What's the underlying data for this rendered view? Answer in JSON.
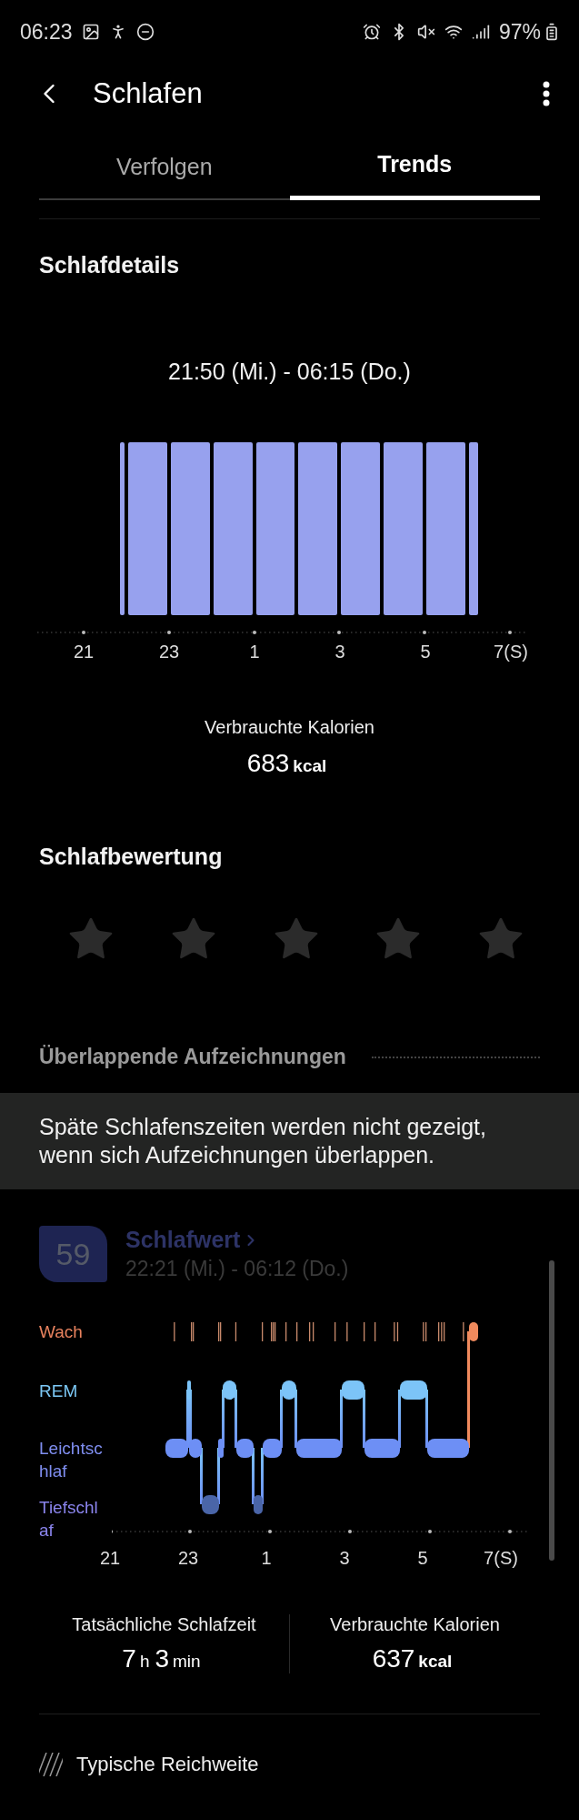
{
  "status_bar": {
    "time": "06:23",
    "battery": "97%"
  },
  "header": {
    "title": "Schlafen"
  },
  "tabs": [
    {
      "label": "Verfolgen",
      "selected": false
    },
    {
      "label": "Trends",
      "selected": true
    }
  ],
  "sleep_details": {
    "title": "Schlafdetails",
    "range": "21:50 (Mi.) - 06:15 (Do.)",
    "x_axis_labels": [
      "21",
      "23",
      "1",
      "3",
      "5",
      "7(S)"
    ],
    "calories_label": "Verbrauchte Kalorien",
    "calories_value": "683",
    "calories_unit": "kcal"
  },
  "rating": {
    "title": "Schlafbewertung",
    "stars": 0
  },
  "overlap": {
    "title": "Überlappende Aufzeichnungen",
    "notice": "Späte Schlafenszeiten werden nicht gezeigt, wenn sich Aufzeichnungen überlappen."
  },
  "record": {
    "score": "59",
    "title": "Schlafwert",
    "range": "22:21 (Mi.) - 06:12 (Do.)",
    "stages": [
      {
        "label": "Wach",
        "color": "#e8825e"
      },
      {
        "label": "REM",
        "color": "#7cc8f5"
      },
      {
        "label": "Leichtschlaf",
        "color": "#7f8ef0"
      },
      {
        "label": "Tiefschlaf",
        "color": "#8a84ec"
      }
    ],
    "x_axis_labels": [
      "21",
      "23",
      "1",
      "3",
      "5",
      "7(S)"
    ],
    "stats": [
      {
        "label": "Tatsächliche Schlafzeit",
        "kind": "duration",
        "parts": [
          {
            "number": "7",
            "unit": "h"
          },
          {
            "number": "3",
            "unit": "min"
          }
        ]
      },
      {
        "label": "Verbrauchte Kalorien",
        "kind": "calories",
        "parts": [
          {
            "number": "637",
            "unit": "kcal"
          }
        ]
      }
    ]
  },
  "legend": {
    "label": "Typische Reichweite"
  }
}
